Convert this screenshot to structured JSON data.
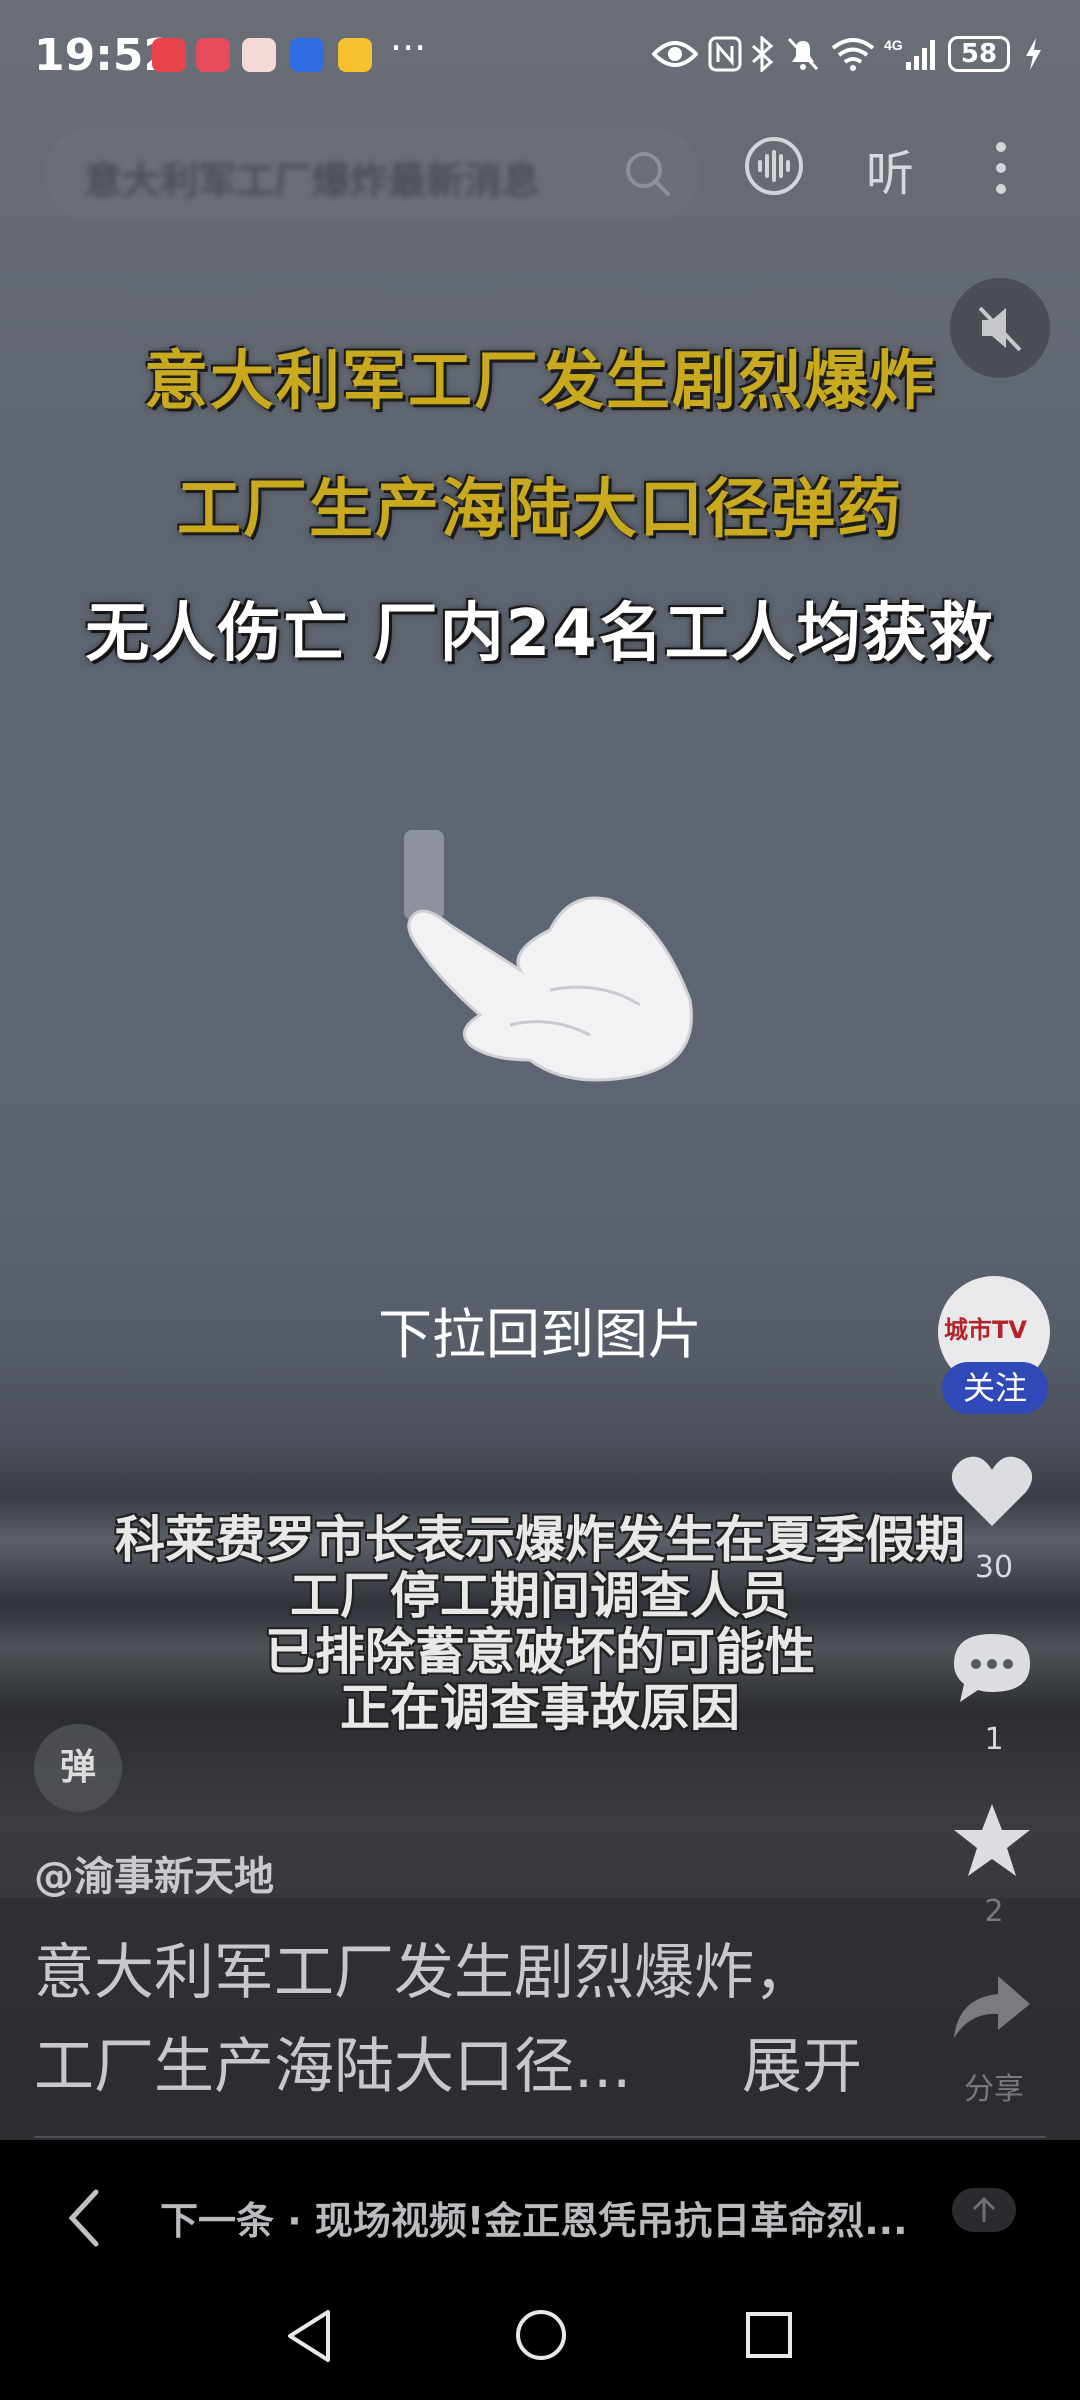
{
  "status_bar": {
    "time": "19:52",
    "more": "···",
    "battery": "58"
  },
  "top_bar": {
    "search_placeholder": "意大利军工厂爆炸最新消息",
    "listen_label": "听"
  },
  "video": {
    "headline_lines": [
      "意大利军工厂发生剧烈爆炸",
      "工厂生产海陆大口径弹药",
      "无人伤亡 厂内24名工人均获救"
    ],
    "pull_hint": "下拉回到图片",
    "subtitles": [
      "科莱费罗市长表示爆炸发生在夏季假期",
      "工厂停工期间调查人员",
      "已排除蓄意破坏的可能性",
      "正在调查事故原因"
    ],
    "danmaku_label": "弹"
  },
  "side_rail": {
    "avatar_text": "城市TV",
    "follow_label": "关注",
    "like_count": "30",
    "comment_count": "1",
    "favorite_count": "2",
    "share_label": "分享"
  },
  "post": {
    "author": "@渝事新天地",
    "desc_line1": "意大利军工厂发生剧烈爆炸，",
    "desc_line2": "工厂生产海陆大口径...",
    "expand_label": "展开"
  },
  "next_bar": {
    "text": "下一条 · 现场视频!金正恩凭吊抗日革命烈..."
  },
  "colors": {
    "headline_yellow": "#c9a91d",
    "follow_blue": "#2f49b8"
  }
}
